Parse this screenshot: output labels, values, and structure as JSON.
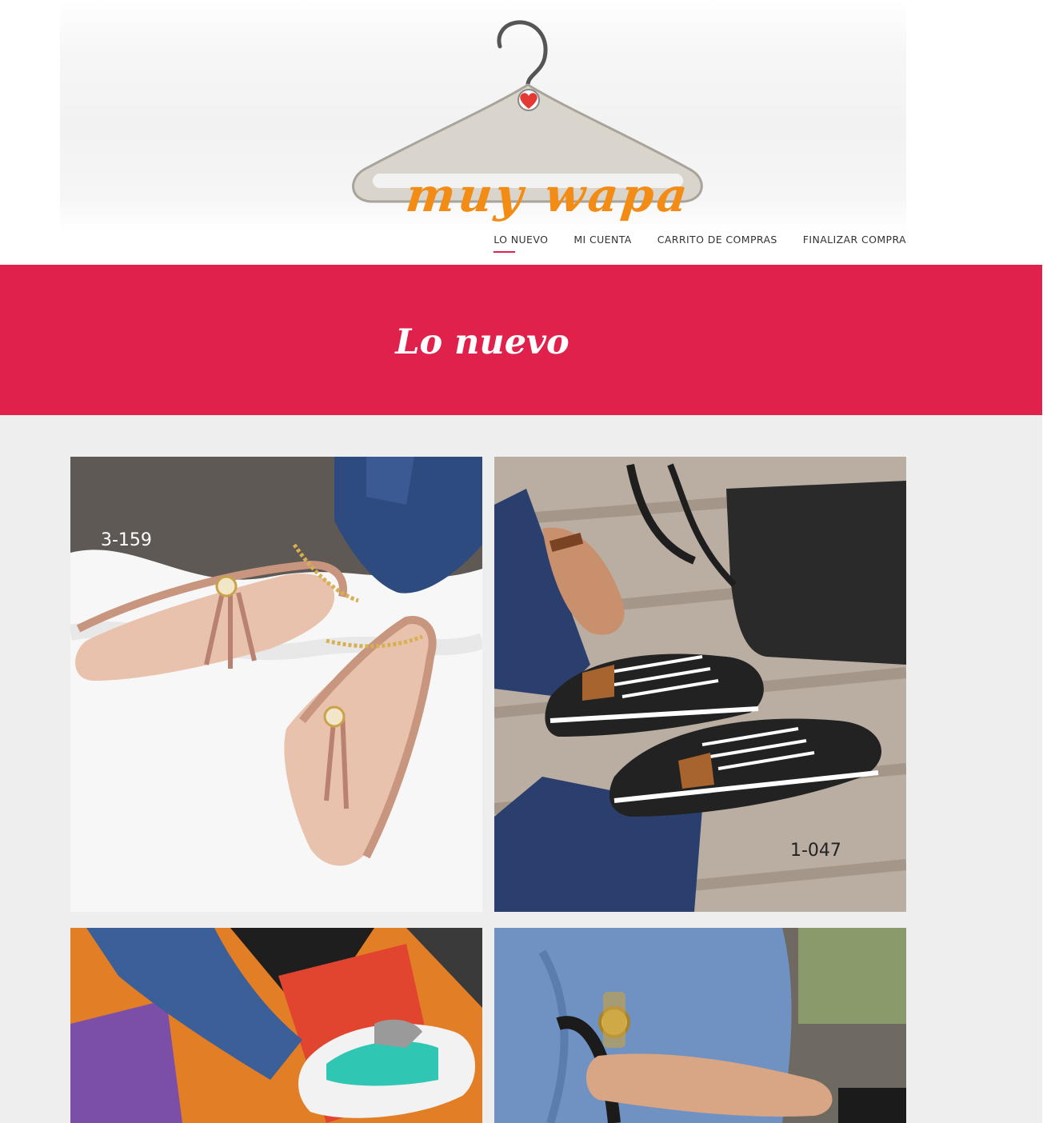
{
  "brand": {
    "name": "muy wapa",
    "logo_colors": {
      "hanger": "#bdb8ae",
      "heart": "#e53935",
      "text": "#f28c15"
    }
  },
  "nav": {
    "items": [
      {
        "label": "LO NUEVO",
        "active": true
      },
      {
        "label": "MI CUENTA",
        "active": false
      },
      {
        "label": "CARRITO DE COMPRAS",
        "active": false
      },
      {
        "label": "FINALIZAR COMPRA",
        "active": false
      }
    ]
  },
  "banner": {
    "title": "Lo nuevo",
    "color": "#e0214c"
  },
  "products": [
    {
      "code": "3-159"
    },
    {
      "code": "1-047"
    },
    {
      "code": ""
    },
    {
      "code": ""
    }
  ]
}
